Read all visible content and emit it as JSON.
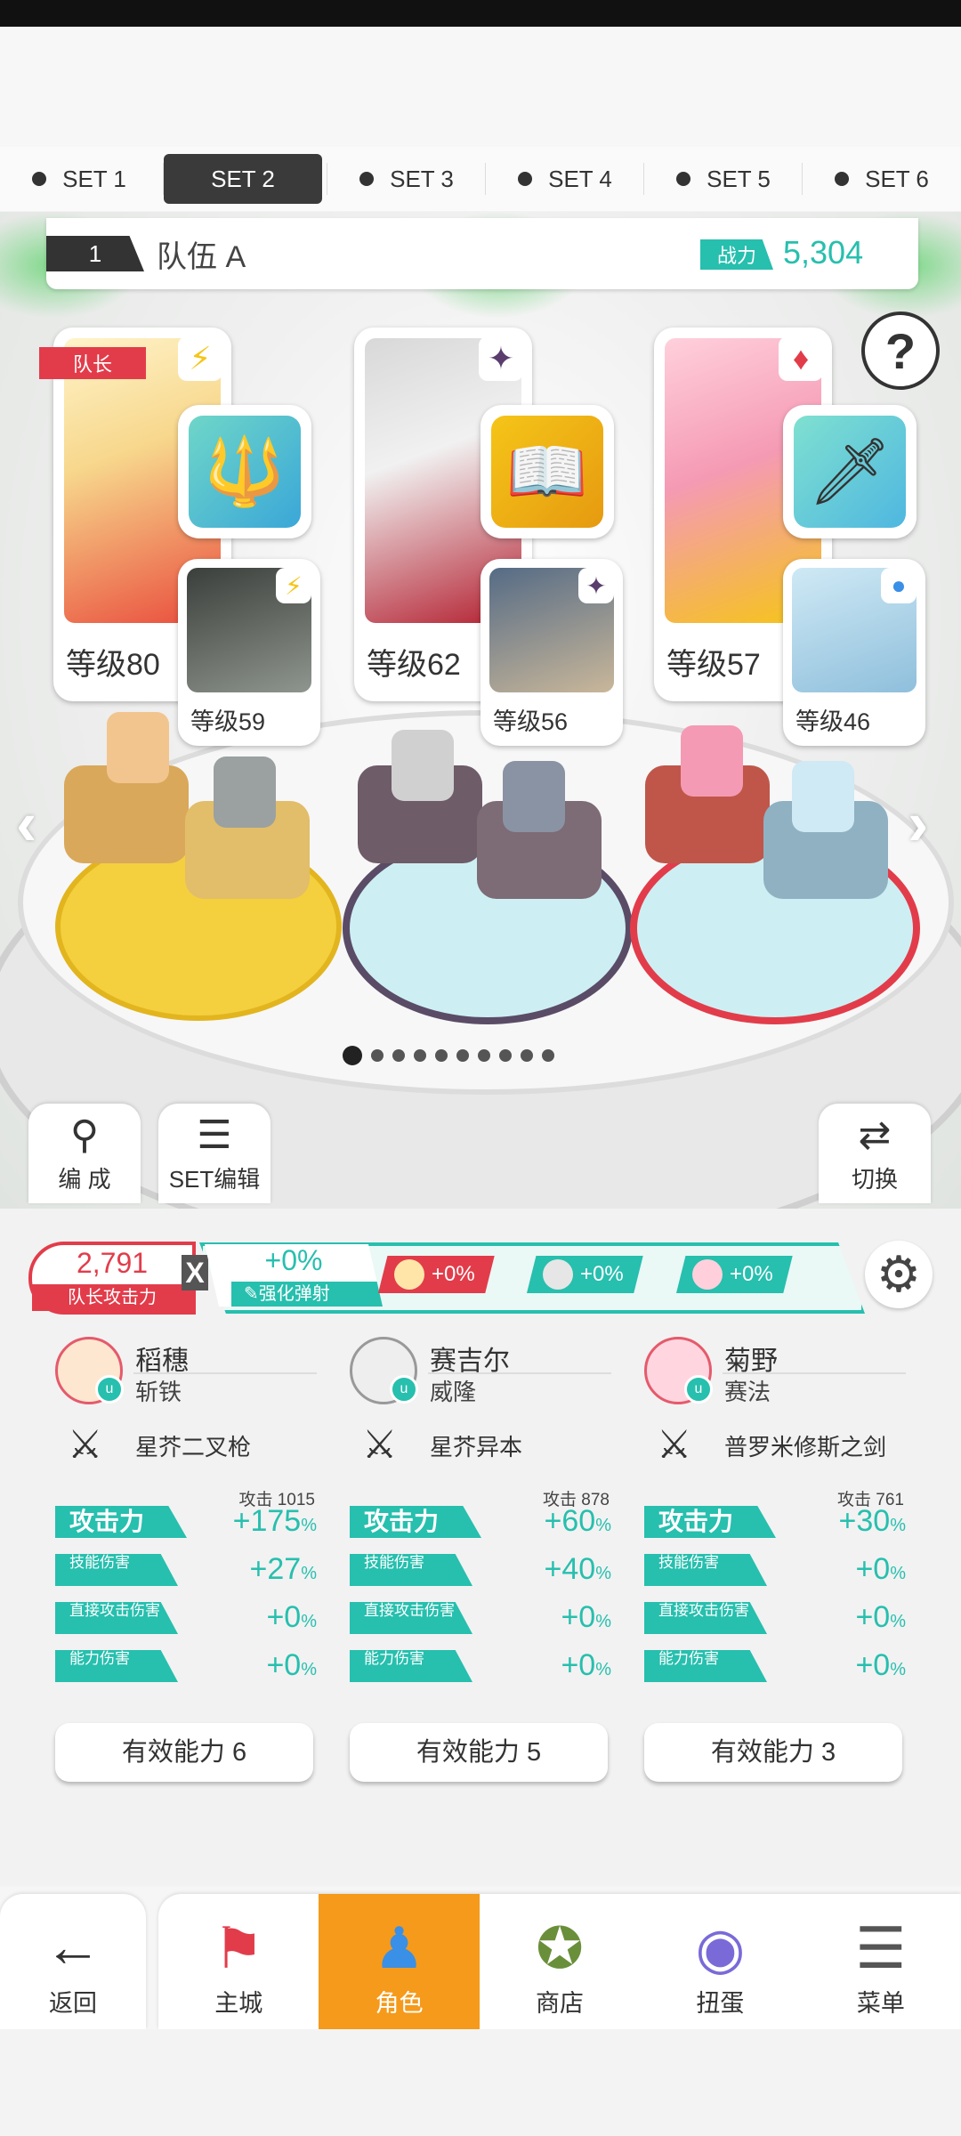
{
  "set_tabs": [
    {
      "label": "SET 1",
      "active": false
    },
    {
      "label": "SET 2",
      "active": true
    },
    {
      "label": "SET 3",
      "active": false
    },
    {
      "label": "SET 4",
      "active": false
    },
    {
      "label": "SET 5",
      "active": false
    },
    {
      "label": "SET 6",
      "active": false
    }
  ],
  "team": {
    "number": "1",
    "name": "队伍 A",
    "power_label": "战力",
    "power_value": "5,304"
  },
  "help": "?",
  "leader_badge": "队长",
  "heroes": [
    {
      "level": "等级80",
      "element_icon": "lightning-icon",
      "element_glyph": "⚡",
      "weapon_icon": "trident-icon",
      "weapon_glyph": "🔱",
      "sub": {
        "level": "等级59",
        "element_glyph": "⚡"
      }
    },
    {
      "level": "等级62",
      "element_icon": "dark-star-icon",
      "element_glyph": "✦",
      "weapon_icon": "book-icon",
      "weapon_glyph": "📖",
      "sub": {
        "level": "等级56",
        "element_glyph": "✦"
      }
    },
    {
      "level": "等级57",
      "element_icon": "fire-diamond-icon",
      "element_glyph": "♦",
      "weapon_icon": "sword-icon",
      "weapon_glyph": "🗡",
      "sub": {
        "level": "等级46",
        "element_glyph": "●"
      }
    }
  ],
  "pager": {
    "count": 10,
    "active": 0
  },
  "side_buttons": {
    "formation": "编 成",
    "set_edit": "SET编辑",
    "switch": "切换"
  },
  "leader_attack": {
    "value": "2,791",
    "label": "队长攻击力"
  },
  "multiply": "X",
  "reinforce": {
    "value": "+0%",
    "label": "强化弹射"
  },
  "hero_buffs": [
    "+0%",
    "+0%",
    "+0%"
  ],
  "columns": [
    {
      "name": "稻穗",
      "class": "斩铁",
      "weapon": "星芥二叉枪",
      "atk_base": "攻击 1015",
      "stats": {
        "attack_label": "攻击力",
        "attack": "+175",
        "skill_label": "技能伤害",
        "skill": "+27",
        "direct_label": "直接攻击伤害",
        "direct": "+0",
        "ability_label": "能力伤害",
        "ability": "+0"
      },
      "effective": "有效能力 6"
    },
    {
      "name": "赛吉尔",
      "class": "威隆",
      "weapon": "星芥异本",
      "atk_base": "攻击 878",
      "stats": {
        "attack_label": "攻击力",
        "attack": "+60",
        "skill_label": "技能伤害",
        "skill": "+40",
        "direct_label": "直接攻击伤害",
        "direct": "+0",
        "ability_label": "能力伤害",
        "ability": "+0"
      },
      "effective": "有效能力 5"
    },
    {
      "name": "菊野",
      "class": "赛法",
      "weapon": "普罗米修斯之剑",
      "atk_base": "攻击 761",
      "stats": {
        "attack_label": "攻击力",
        "attack": "+30",
        "skill_label": "技能伤害",
        "skill": "+0",
        "direct_label": "直接攻击伤害",
        "direct": "+0",
        "ability_label": "能力伤害",
        "ability": "+0"
      },
      "effective": "有效能力 3"
    }
  ],
  "percent_sign": "%",
  "nav": {
    "back": "返回",
    "items": [
      "主城",
      "角色",
      "商店",
      "扭蛋",
      "菜单"
    ],
    "active_index": 1
  },
  "colors": {
    "accent": "#27bfae",
    "leader_red": "#e23c4a",
    "nav_active": "#f59a1b"
  }
}
